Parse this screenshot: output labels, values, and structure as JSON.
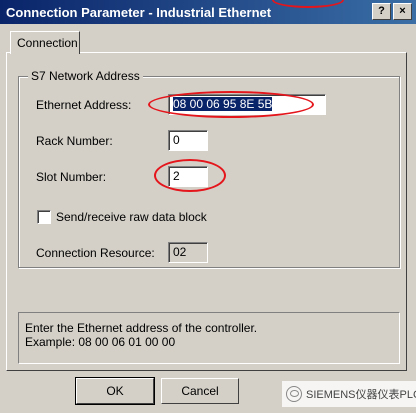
{
  "window": {
    "title": "Connection Parameter - Industrial Ethernet",
    "help_label": "?",
    "close_label": "×"
  },
  "tabs": [
    {
      "label": "Connection"
    }
  ],
  "group": {
    "title": "S7 Network Address",
    "ethernet_address_label": "Ethernet Address:",
    "ethernet_address_value": "08 00 06 95 8E 5B",
    "rack_number_label": "Rack Number:",
    "rack_number_value": "0",
    "slot_number_label": "Slot Number:",
    "slot_number_value": "2",
    "raw_block_label": "Send/receive raw data block",
    "raw_block_checked": false,
    "connection_resource_label": "Connection Resource:",
    "connection_resource_value": "02"
  },
  "info": {
    "line1": "Enter the Ethernet address of the controller.",
    "line2": "Example: 08 00 06 01 00 00"
  },
  "buttons": {
    "ok_label": "OK",
    "cancel_label": "Cancel"
  },
  "watermark": {
    "text": "SIEMENS仪器仪表PLC"
  },
  "colors": {
    "titlebar": "#0a246a",
    "dialog_bg": "#d4d0c8",
    "annotation": "#e4161c",
    "selection": "#0a246a"
  }
}
